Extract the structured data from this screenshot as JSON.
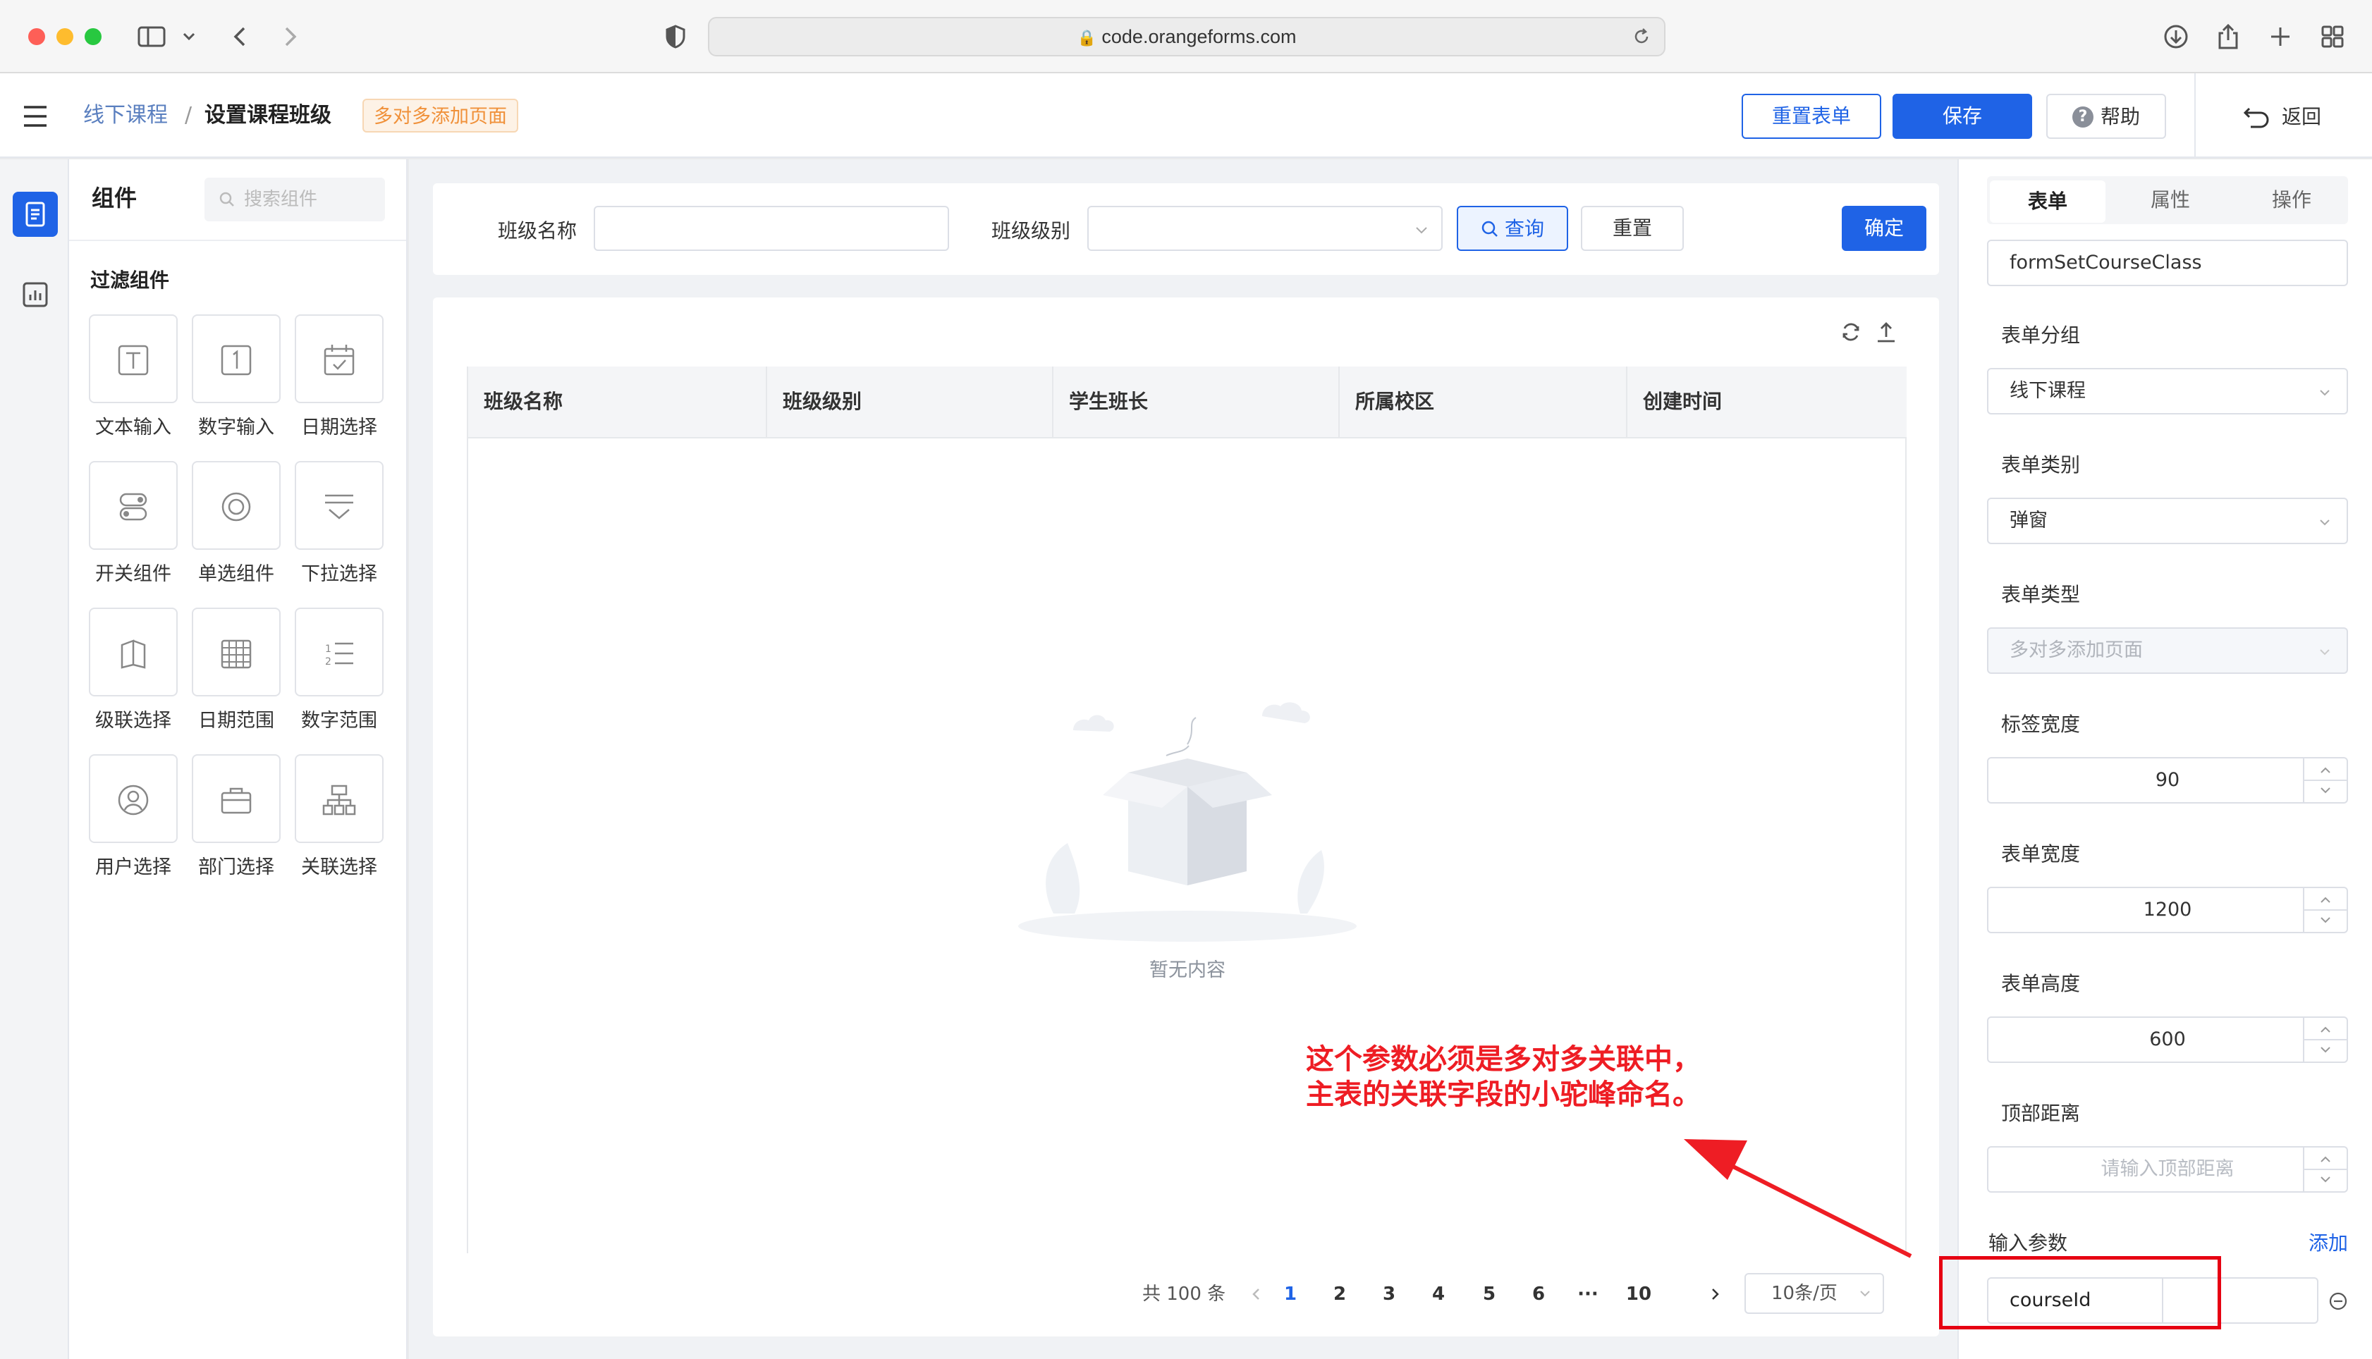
{
  "browser": {
    "url": "code.orangeforms.com"
  },
  "header": {
    "breadcrumb_root": "线下课程",
    "breadcrumb_sep": "/",
    "breadcrumb_current": "设置课程班级",
    "badge": "多对多添加页面",
    "reset_form": "重置表单",
    "save": "保存",
    "help": "帮助",
    "back": "返回"
  },
  "component_panel": {
    "title": "组件",
    "search_placeholder": "搜索组件",
    "section_title": "过滤组件",
    "items": [
      {
        "label": "文本输入",
        "icon": "text-input-icon"
      },
      {
        "label": "数字输入",
        "icon": "number-input-icon"
      },
      {
        "label": "日期选择",
        "icon": "date-picker-icon"
      },
      {
        "label": "开关组件",
        "icon": "switch-icon"
      },
      {
        "label": "单选组件",
        "icon": "radio-icon"
      },
      {
        "label": "下拉选择",
        "icon": "dropdown-icon"
      },
      {
        "label": "级联选择",
        "icon": "cascader-icon"
      },
      {
        "label": "日期范围",
        "icon": "date-range-icon"
      },
      {
        "label": "数字范围",
        "icon": "number-range-icon"
      },
      {
        "label": "用户选择",
        "icon": "user-select-icon"
      },
      {
        "label": "部门选择",
        "icon": "dept-select-icon"
      },
      {
        "label": "关联选择",
        "icon": "relation-select-icon"
      }
    ]
  },
  "filter": {
    "class_name_label": "班级名称",
    "class_name_value": "",
    "class_level_label": "班级级别",
    "class_level_value": "",
    "query": "查询",
    "reset": "重置",
    "confirm": "确定"
  },
  "table": {
    "columns": [
      "班级名称",
      "班级级别",
      "学生班长",
      "所属校区",
      "创建时间"
    ],
    "rows": [],
    "empty_text": "暂无内容"
  },
  "pagination": {
    "total": "共 100 条",
    "pages": [
      "1",
      "2",
      "3",
      "4",
      "5",
      "6",
      "···",
      "10"
    ],
    "current": "1",
    "page_size": "10条/页"
  },
  "properties": {
    "tabs": [
      "表单",
      "属性",
      "操作"
    ],
    "active_tab": "表单",
    "form_name": "formSetCourseClass",
    "group_label": "表单分组",
    "group_value": "线下课程",
    "category_label": "表单类别",
    "category_value": "弹窗",
    "type_label": "表单类型",
    "type_value": "多对多添加页面",
    "label_width_label": "标签宽度",
    "label_width": "90",
    "form_width_label": "表单宽度",
    "form_width": "1200",
    "form_height_label": "表单高度",
    "form_height": "600",
    "top_distance_label": "顶部距离",
    "top_distance_placeholder": "请输入顶部距离",
    "params_label": "输入参数",
    "add": "添加",
    "param_name": "courseId",
    "param_value": ""
  },
  "annotation": {
    "line1": "这个参数必须是多对多关联中，",
    "line2": "主表的关联字段的小驼峰命名。",
    "color": "#ee1d24"
  },
  "colors": {
    "primary": "#1f63e6",
    "badge": "#f0913a"
  }
}
